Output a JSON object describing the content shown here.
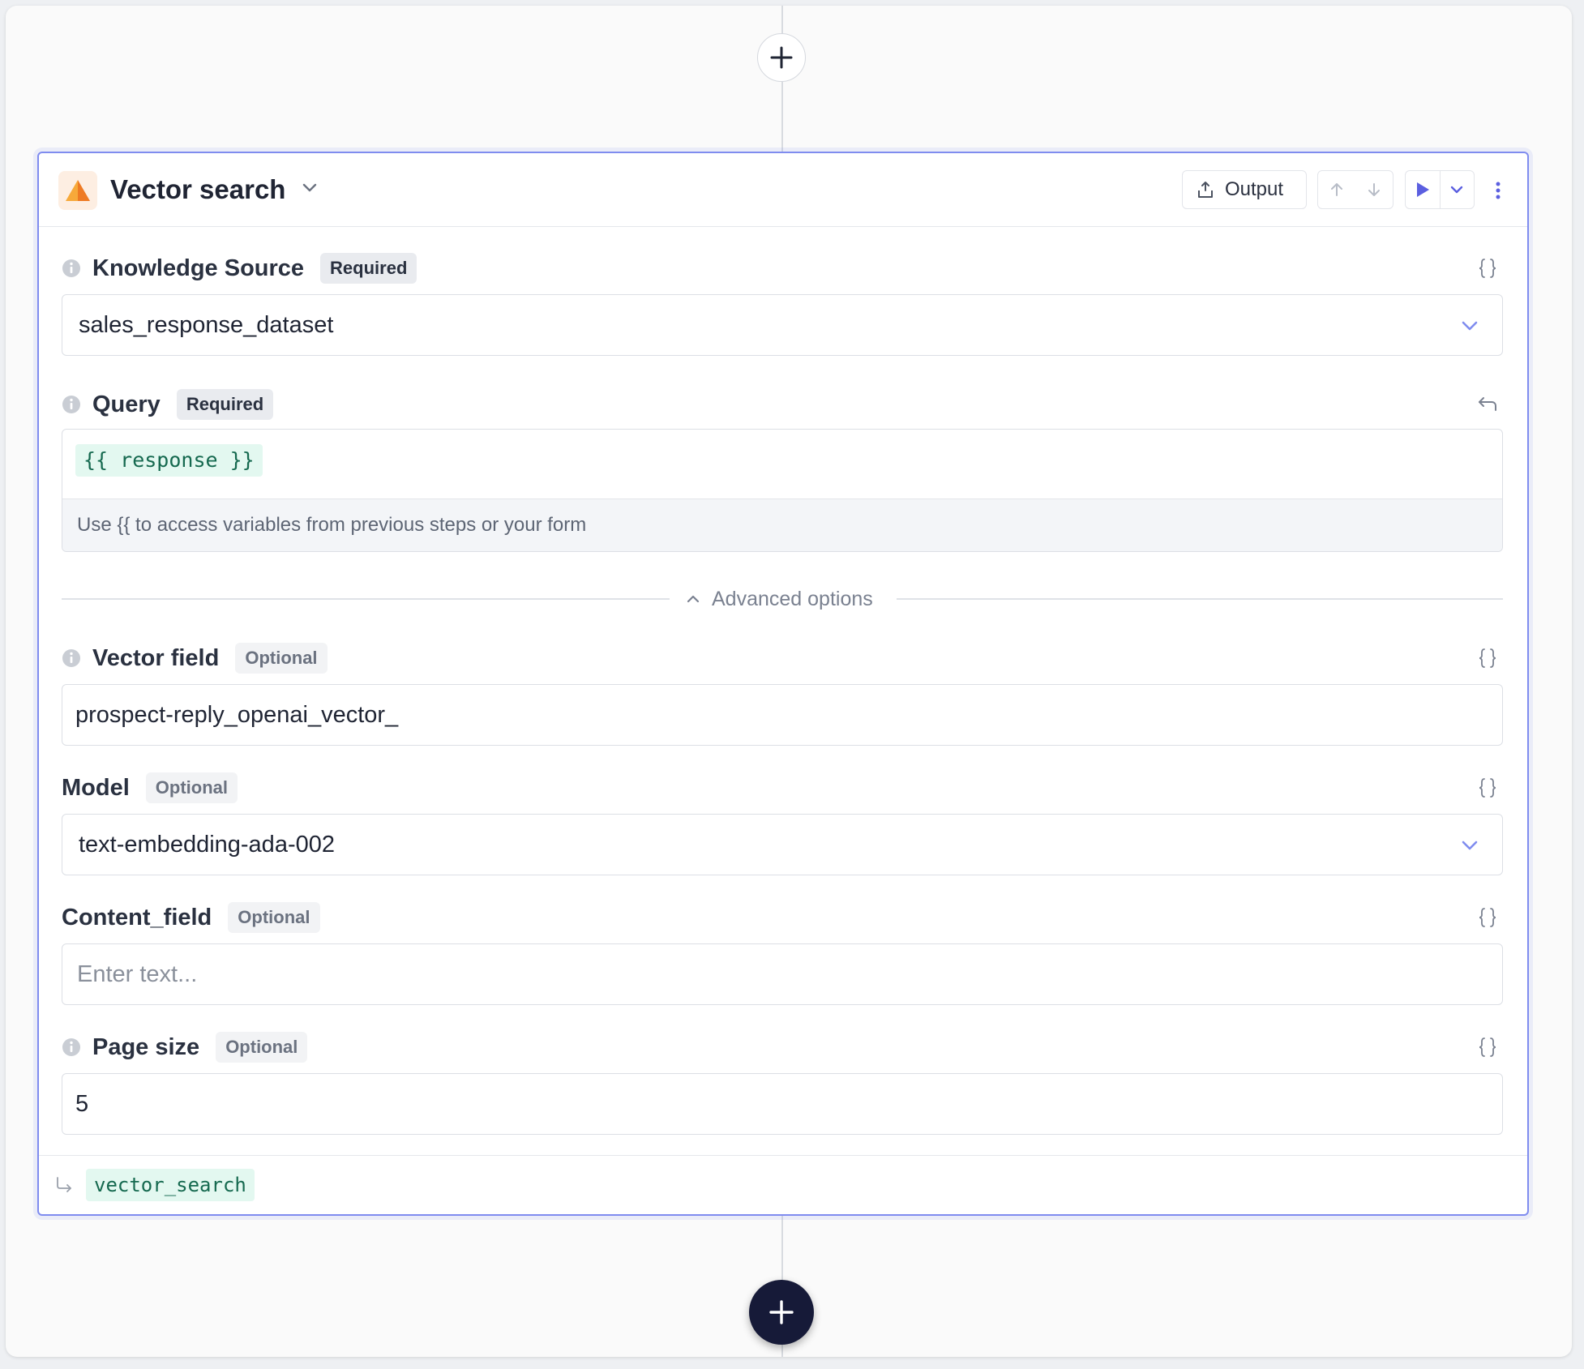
{
  "step": {
    "title": "Vector search",
    "icon": "pyramid-icon",
    "output_label": "Output"
  },
  "fields": {
    "knowledge_source": {
      "label": "Knowledge Source",
      "badge": "Required",
      "value": "sales_response_dataset"
    },
    "query": {
      "label": "Query",
      "badge": "Required",
      "variable": "{{ response }}",
      "hint": "Use {{ to access variables from previous steps or your form"
    },
    "advanced_options_label": "Advanced options",
    "vector_field": {
      "label": "Vector field",
      "badge": "Optional",
      "value": "prospect-reply_openai_vector_"
    },
    "model": {
      "label": "Model",
      "badge": "Optional",
      "value": "text-embedding-ada-002"
    },
    "content_field": {
      "label": "Content_field",
      "badge": "Optional",
      "placeholder": "Enter text..."
    },
    "page_size": {
      "label": "Page size",
      "badge": "Optional",
      "value": "5"
    }
  },
  "output_variable": "vector_search",
  "colors": {
    "accent": "#7f8cef",
    "run": "#5b5fe0",
    "chip_bg": "#e3f8f0",
    "chip_text": "#15694f",
    "add_button_dark": "#161a38"
  }
}
